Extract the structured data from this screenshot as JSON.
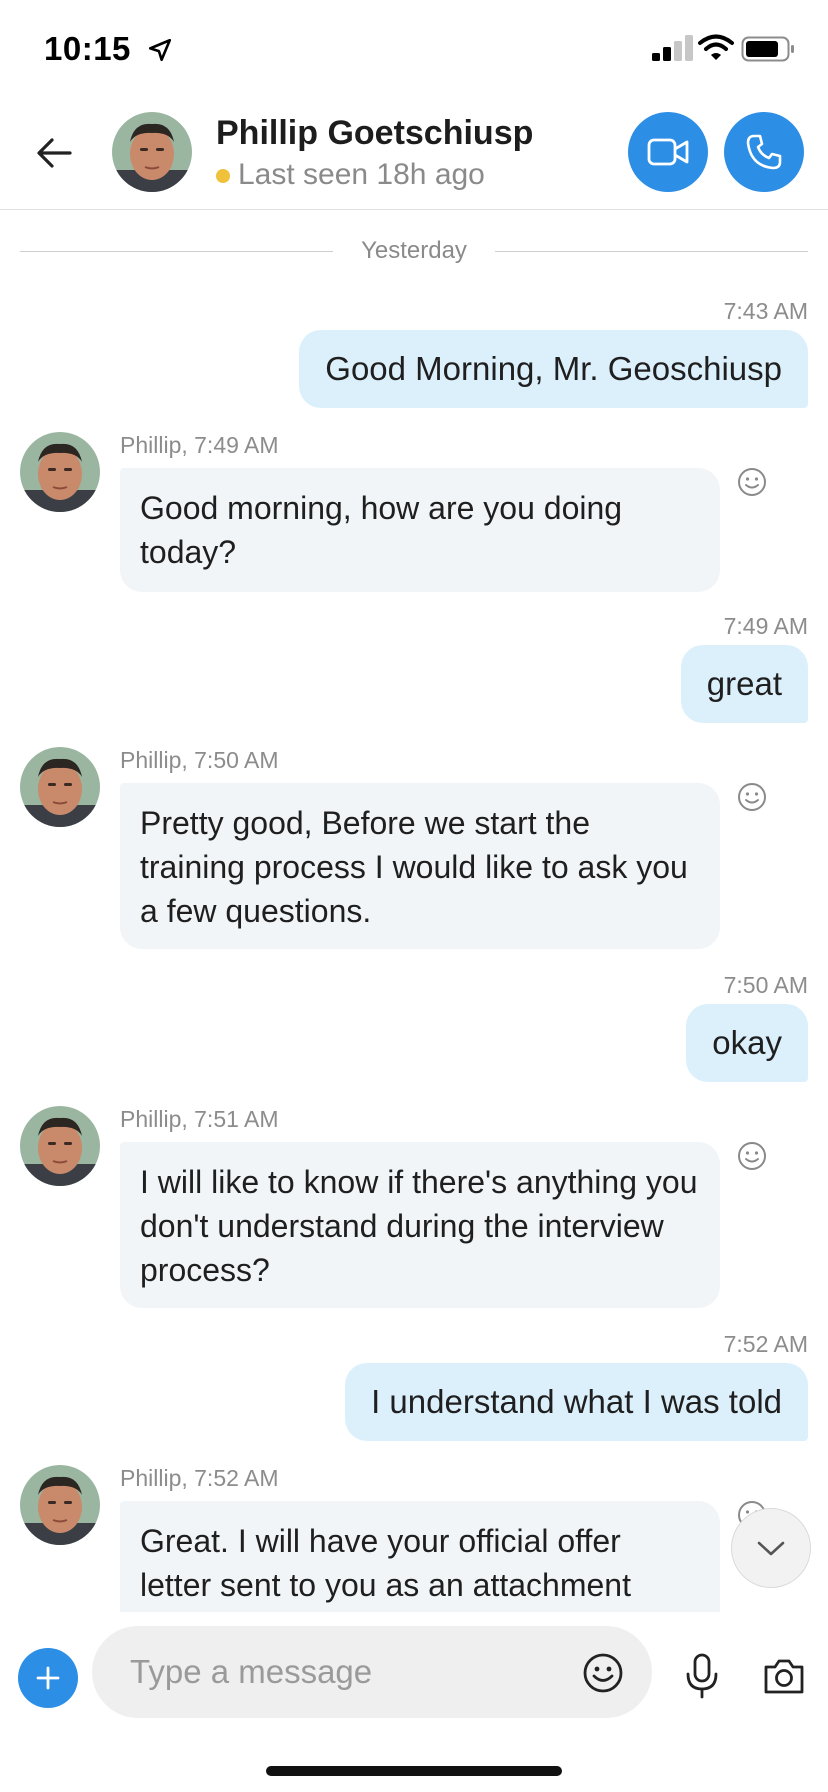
{
  "status_bar": {
    "time": "10:15"
  },
  "header": {
    "contact_name": "Phillip Goetschiusp",
    "presence": "Last seen 18h ago",
    "presence_color": "#f0c13a",
    "accent_color": "#2d8ee6"
  },
  "divider": {
    "label": "Yesterday"
  },
  "messages": [
    {
      "direction": "out",
      "time": "7:43 AM",
      "text": "Good Morning, Mr. Geoschiusp"
    },
    {
      "direction": "in",
      "meta": "Phillip, 7:49 AM",
      "text": "Good morning, how are you doing today?"
    },
    {
      "direction": "out",
      "time": "7:49 AM",
      "text": "great"
    },
    {
      "direction": "in",
      "meta": "Phillip, 7:50 AM",
      "text": "Pretty good, Before we start the training process I would like to ask you a few questions."
    },
    {
      "direction": "out",
      "time": "7:50 AM",
      "text": "okay"
    },
    {
      "direction": "in",
      "meta": "Phillip, 7:51 AM",
      "text": "I will like to know if there's anything you don't understand during the interview process?"
    },
    {
      "direction": "out",
      "time": "7:52 AM",
      "text": "I understand what I was told"
    },
    {
      "direction": "in",
      "meta": "Phillip, 7:52 AM",
      "text": "Great. I will have your official offer letter sent to you as an attachment"
    }
  ],
  "composer": {
    "placeholder": "Type a message"
  },
  "icons": {
    "back": "arrow-left-icon",
    "video": "video-camera-icon",
    "phone": "phone-icon",
    "react": "smiley-icon",
    "scroll_down": "chevron-down-icon",
    "add": "plus-icon",
    "emoji": "emoji-icon",
    "mic": "microphone-icon",
    "camera": "camera-icon"
  }
}
